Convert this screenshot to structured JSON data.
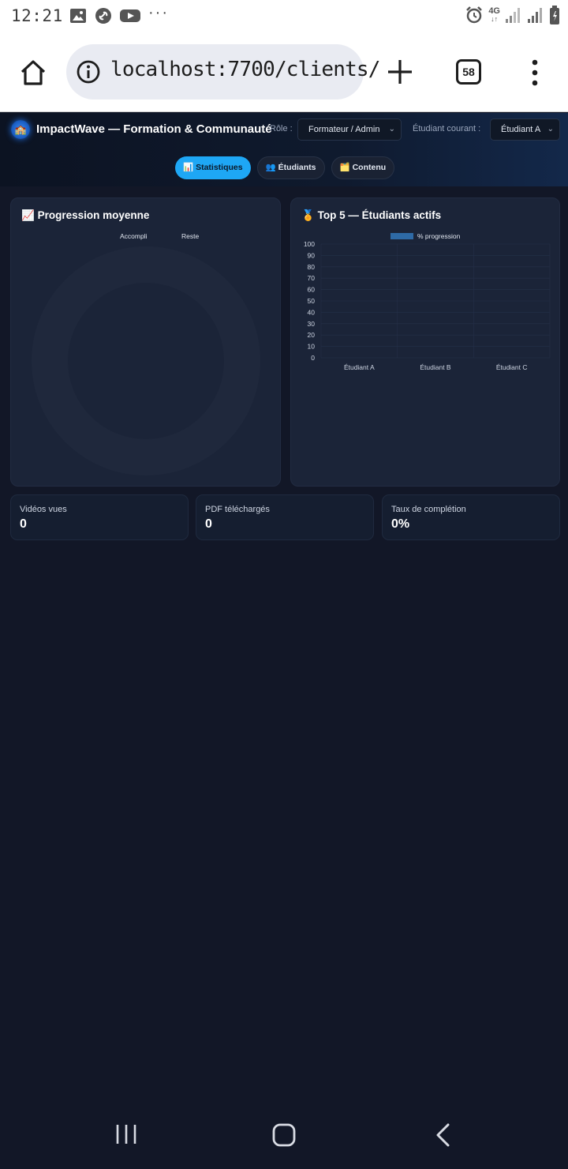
{
  "status_bar": {
    "time": "12:21",
    "network": "4G",
    "icons_left": [
      "image-icon",
      "link-icon",
      "youtube-icon",
      "more-dots-icon"
    ],
    "icons_right": [
      "alarm-icon",
      "signal-icon",
      "signal-icon",
      "battery-icon"
    ]
  },
  "browser": {
    "url": "localhost:7700/clients/",
    "tab_count": "58"
  },
  "app": {
    "logo_glyph": "🏫",
    "title": "ImpactWave — Formation & Communauté",
    "role_label": "Rôle :",
    "role_value": "Formateur / Admin",
    "student_label": "Étudiant courant :",
    "student_value": "Étudiant A",
    "tabs": [
      {
        "icon": "📊",
        "label": "Statistiques",
        "active": true
      },
      {
        "icon": "👥",
        "label": "Étudiants",
        "active": false
      },
      {
        "icon": "🗂️",
        "label": "Contenu",
        "active": false
      }
    ]
  },
  "progress_card": {
    "icon": "📈",
    "title": "Progression moyenne",
    "legend": [
      "Accompli",
      "Reste"
    ],
    "values": [
      0,
      0
    ]
  },
  "top5_card": {
    "icon": "🏅",
    "title": "Top 5 — Étudiants actifs"
  },
  "chart_data": {
    "type": "bar",
    "categories": [
      "Étudiant A",
      "Étudiant B",
      "Étudiant C"
    ],
    "series": [
      {
        "name": "% progression",
        "values": [
          0,
          0,
          0
        ],
        "color": "#2e6aa6"
      }
    ],
    "ylim": [
      0,
      100
    ],
    "yticks": [
      100,
      90,
      80,
      70,
      60,
      50,
      40,
      30,
      20,
      10,
      0
    ],
    "grid": true,
    "legend": "top"
  },
  "stats": [
    {
      "label": "Vidéos vues",
      "value": "0"
    },
    {
      "label": "PDF téléchargés",
      "value": "0"
    },
    {
      "label": "Taux de complétion",
      "value": "0%"
    }
  ],
  "colors": {
    "background": "#121727",
    "card": "#1b2438",
    "accent": "#1ea7f5",
    "bar": "#2e6aa6"
  }
}
